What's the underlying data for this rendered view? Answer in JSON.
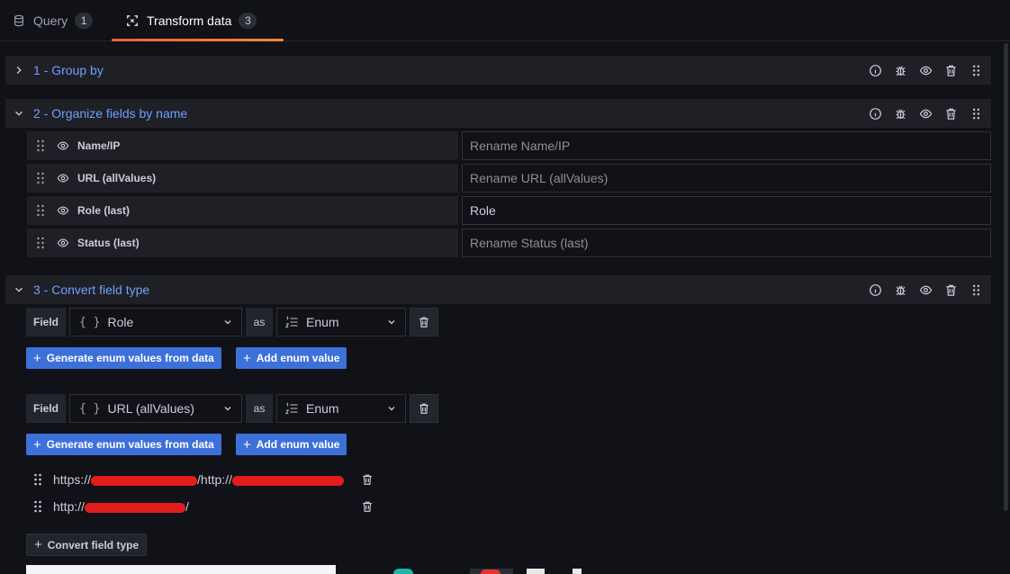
{
  "tabs": [
    {
      "label": "Query",
      "count": "1",
      "active": false,
      "icon": "database-icon"
    },
    {
      "label": "Transform data",
      "count": "3",
      "active": true,
      "icon": "transform-icon"
    }
  ],
  "sections": [
    {
      "title": "1 - Group by",
      "expanded": false
    },
    {
      "title": "2 - Organize fields by name",
      "expanded": true
    },
    {
      "title": "3 - Convert field type",
      "expanded": true
    }
  ],
  "organize": {
    "rows": [
      {
        "label": "Name/IP",
        "value": "",
        "placeholder": "Rename Name/IP"
      },
      {
        "label": "URL (allValues)",
        "value": "",
        "placeholder": "Rename URL (allValues)"
      },
      {
        "label": "Role (last)",
        "value": "Role",
        "placeholder": "Rename Role (last)"
      },
      {
        "label": "Status (last)",
        "value": "",
        "placeholder": "Rename Status (last)"
      }
    ]
  },
  "convert": {
    "field_label": "Field",
    "as_label": "as",
    "rows": [
      {
        "field_icon": "{ }",
        "field": "Role",
        "type": "Enum"
      },
      {
        "field_icon": "{ }",
        "field": "URL (allValues)",
        "type": "Enum"
      }
    ],
    "generate_label": "Generate enum values from data",
    "add_label": "Add enum value",
    "enum_values": [
      {
        "prefix": "https://",
        "middle": "/http://",
        "suffix": ""
      },
      {
        "prefix": "http://",
        "middle": "",
        "suffix": "/"
      }
    ],
    "add_transform_label": "Convert field type"
  },
  "colors": {
    "accent_link": "#6e9fff",
    "primary_button": "#3d71d9",
    "tab_underline": "#f55f3e",
    "redaction": "#e21d1d"
  }
}
